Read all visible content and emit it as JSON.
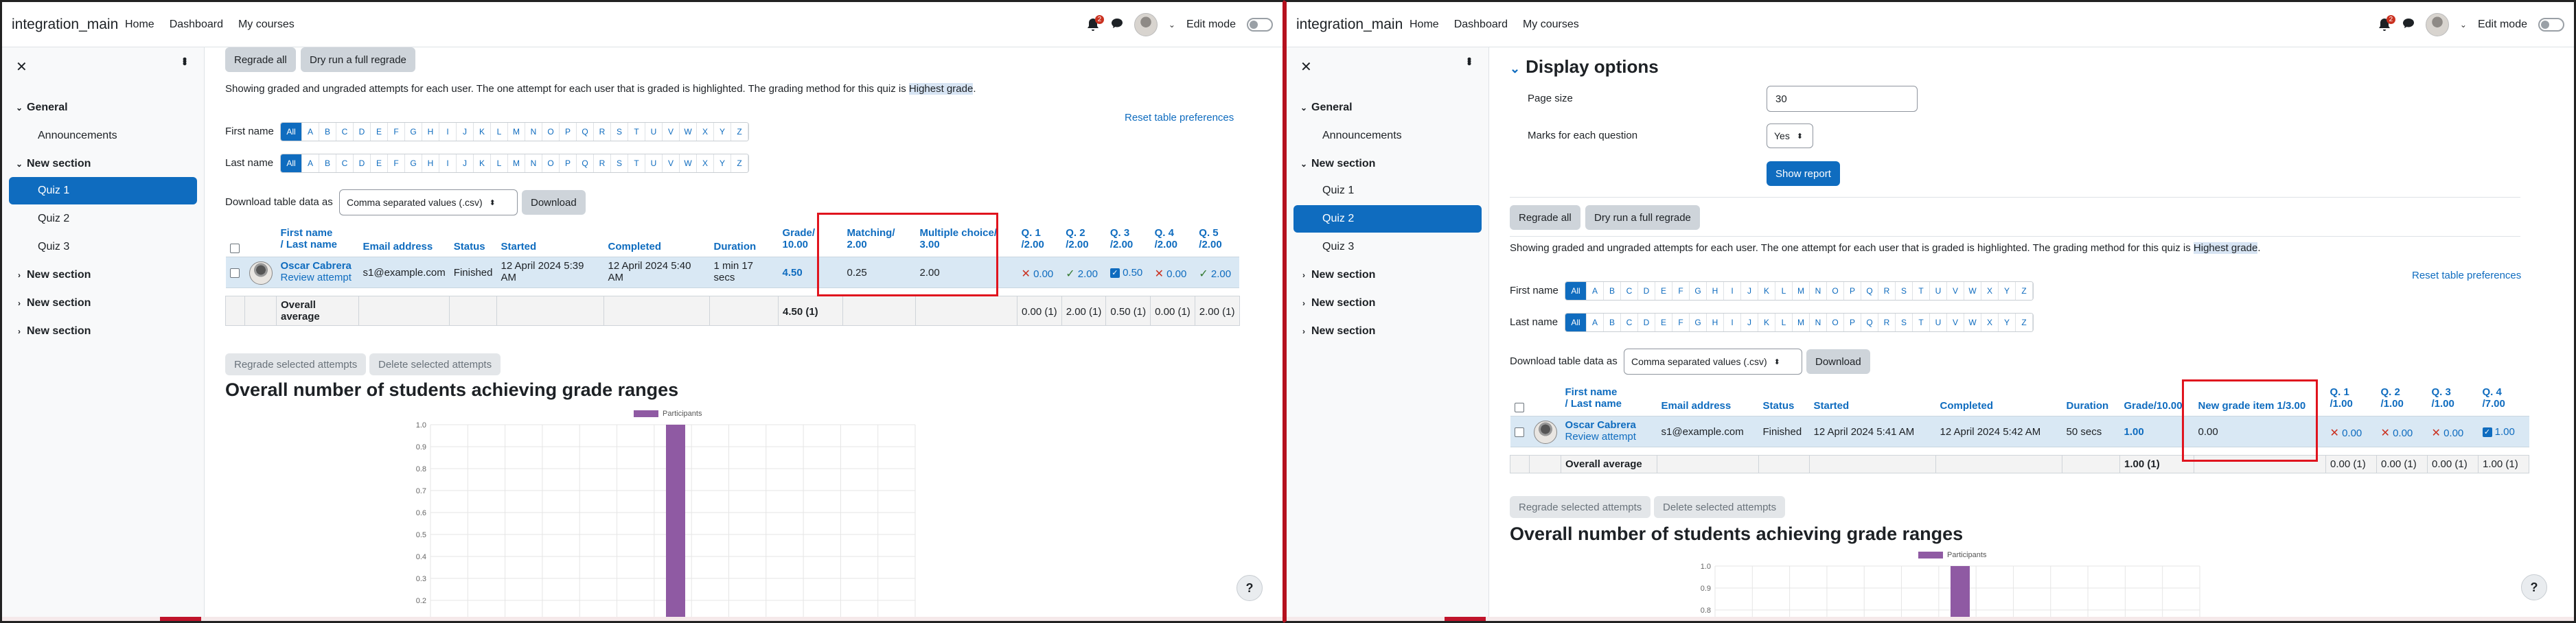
{
  "nav": {
    "site_name": "integration_main",
    "links": [
      "Home",
      "Dashboard",
      "My courses"
    ],
    "notif_count": "2",
    "edit_mode": "Edit mode"
  },
  "drawer": {
    "close": "✕",
    "items": [
      {
        "label": "General",
        "type": "section"
      },
      {
        "label": "Announcements",
        "type": "item"
      },
      {
        "label": "New section",
        "type": "section"
      },
      {
        "label": "Quiz 1",
        "type": "item"
      },
      {
        "label": "Quiz 2",
        "type": "item"
      },
      {
        "label": "Quiz 3",
        "type": "item"
      },
      {
        "label": "New section",
        "type": "section"
      },
      {
        "label": "New section",
        "type": "section"
      },
      {
        "label": "New section",
        "type": "section"
      }
    ]
  },
  "common": {
    "regrade_all": "Regrade all",
    "dry_run": "Dry run a full regrade",
    "info_text": "Showing graded and ungraded attempts for each user. The one attempt for each user that is graded is highlighted. The grading method for this quiz is ",
    "grading_method": "Highest grade",
    "reset_prefs": "Reset table preferences",
    "first_name": "First name",
    "last_name": "Last name",
    "letters": [
      "All",
      "A",
      "B",
      "C",
      "D",
      "E",
      "F",
      "G",
      "H",
      "I",
      "J",
      "K",
      "L",
      "M",
      "N",
      "O",
      "P",
      "Q",
      "R",
      "S",
      "T",
      "U",
      "V",
      "W",
      "X",
      "Y",
      "Z"
    ],
    "download_label": "Download table data as",
    "download_format": "Comma separated values (.csv)",
    "download_btn": "Download",
    "regrade_selected": "Regrade selected attempts",
    "delete_selected": "Delete selected attempts",
    "chart_title": "Overall number of students achieving grade ranges",
    "help": "?"
  },
  "left": {
    "active_quiz": "Quiz 1",
    "headers": {
      "first_name": "First name",
      "last_name": "/ Last name",
      "email": "Email address",
      "status": "Status",
      "started": "Started",
      "completed": "Completed",
      "duration": "Duration",
      "grade1": "Grade/",
      "grade2": "10.00",
      "matching1": "Matching/",
      "matching2": "2.00",
      "mc1": "Multiple choice/",
      "mc2": "3.00",
      "q1a": "Q. 1",
      "q1b": "/2.00",
      "q2a": "Q. 2",
      "q2b": "/2.00",
      "q3a": "Q. 3",
      "q3b": "/2.00",
      "q4a": "Q. 4",
      "q4b": "/2.00",
      "q5a": "Q. 5",
      "q5b": "/2.00"
    },
    "row": {
      "name": "Oscar Cabrera",
      "review": "Review attempt",
      "email": "s1@example.com",
      "status": "Finished",
      "started1": "12 April 2024 5:39",
      "started2": "AM",
      "completed1": "12 April 2024 5:40",
      "completed2": "AM",
      "duration1": "1 min 17",
      "duration2": "secs",
      "grade": "4.50",
      "matching": "0.25",
      "mc": "2.00",
      "q1": "0.00",
      "q2": "2.00",
      "q3": "0.50",
      "q4": "0.00",
      "q5": "2.00"
    },
    "avg": {
      "label1": "Overall",
      "label2": "average",
      "grade": "4.50 (1)",
      "q1": "0.00 (1)",
      "q2": "2.00 (1)",
      "q3": "0.50 (1)",
      "q4": "0.00 (1)",
      "q5": "2.00 (1)"
    }
  },
  "right": {
    "active_quiz": "Quiz 2",
    "display_options": "Display options",
    "page_size_label": "Page size",
    "page_size_value": "30",
    "marks_label": "Marks for each question",
    "marks_value": "Yes",
    "show_report": "Show report",
    "headers": {
      "first_name": "First name",
      "last_name": "/ Last name",
      "email": "Email address",
      "status": "Status",
      "started": "Started",
      "completed": "Completed",
      "duration": "Duration",
      "grade": "Grade/10.00",
      "newitem": "New grade item 1/3.00",
      "q1a": "Q. 1",
      "q1b": "/1.00",
      "q2a": "Q. 2",
      "q2b": "/1.00",
      "q3a": "Q. 3",
      "q3b": "/1.00",
      "q4a": "Q. 4",
      "q4b": "/7.00"
    },
    "row": {
      "name": "Oscar Cabrera",
      "review": "Review attempt",
      "email": "s1@example.com",
      "status": "Finished",
      "started": "12 April 2024 5:41 AM",
      "completed": "12 April 2024 5:42 AM",
      "duration": "50 secs",
      "grade": "1.00",
      "newitem": "0.00",
      "q1": "0.00",
      "q2": "0.00",
      "q3": "0.00",
      "q4": "1.00"
    },
    "avg": {
      "label": "Overall average",
      "grade": "1.00 (1)",
      "q1": "0.00 (1)",
      "q2": "0.00 (1)",
      "q3": "0.00 (1)",
      "q4": "1.00 (1)"
    }
  },
  "chart_data": [
    {
      "type": "bar",
      "legend": "Participants",
      "yticks": [
        "1.0",
        "0.9",
        "0.8",
        "0.7",
        "0.6",
        "0.5",
        "0.4",
        "0.3",
        "0.2"
      ],
      "ylim": [
        0,
        1.0
      ],
      "visible_bar_value": 1,
      "color": "#8f5aa3"
    },
    {
      "type": "bar",
      "legend": "Participants",
      "yticks": [
        "1.0",
        "0.9",
        "0.8"
      ],
      "ylim": [
        0,
        1.0
      ],
      "visible_bar_value": 1,
      "color": "#8f5aa3"
    }
  ]
}
